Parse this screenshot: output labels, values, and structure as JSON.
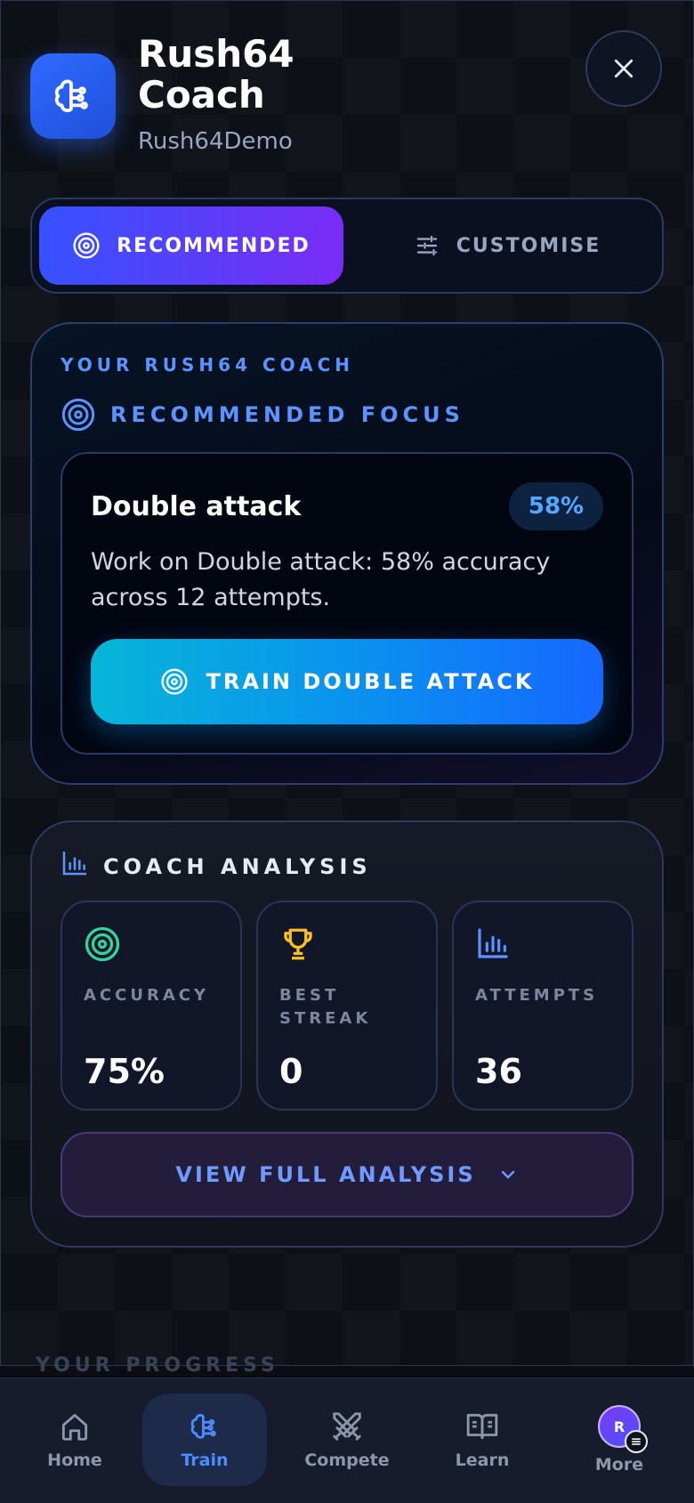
{
  "header": {
    "title": "Rush64 Coach",
    "subtitle": "Rush64Demo",
    "icon": "brain-icon"
  },
  "tabs": [
    {
      "label": "RECOMMENDED",
      "icon": "target-icon",
      "active": true
    },
    {
      "label": "CUSTOMISE",
      "icon": "sliders-icon",
      "active": false
    }
  ],
  "coach": {
    "eyebrow": "YOUR RUSH64 COACH",
    "focus_heading": "RECOMMENDED FOCUS",
    "focus": {
      "title": "Double attack",
      "accuracy_badge": "58%",
      "description": "Work on Double attack: 58% accuracy across 12 attempts.",
      "cta": "TRAIN DOUBLE ATTACK"
    }
  },
  "analysis": {
    "heading": "COACH ANALYSIS",
    "stats": [
      {
        "label": "ACCURACY",
        "value": "75%",
        "icon": "target-icon",
        "color": "#34d399"
      },
      {
        "label": "BEST STREAK",
        "value": "0",
        "icon": "trophy-icon",
        "color": "#fbbf24"
      },
      {
        "label": "ATTEMPTS",
        "value": "36",
        "icon": "bar-chart-icon",
        "color": "#5d93ff"
      }
    ],
    "view_button": "VIEW FULL ANALYSIS"
  },
  "peek_section": "YOUR PROGRESS",
  "nav": [
    {
      "label": "Home",
      "icon": "home-icon"
    },
    {
      "label": "Train",
      "icon": "brain-icon",
      "active": true
    },
    {
      "label": "Compete",
      "icon": "swords-icon"
    },
    {
      "label": "Learn",
      "icon": "book-icon"
    },
    {
      "label": "More",
      "icon": "avatar",
      "avatar_initial": "R"
    }
  ],
  "colors": {
    "accent": "#3652ff",
    "accent_purple": "#7a2cf5",
    "cta_cyan": "#06b6d8",
    "link_blue": "#5d93ff"
  }
}
